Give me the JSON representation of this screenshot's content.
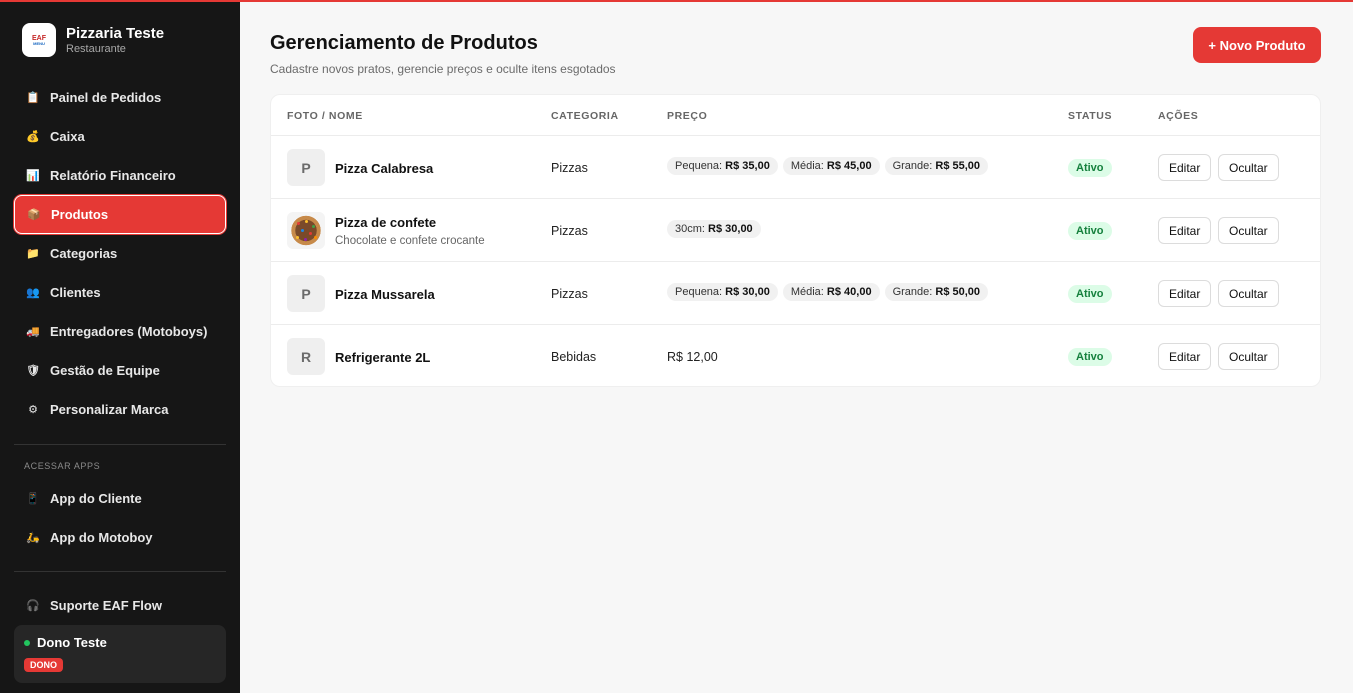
{
  "brand": {
    "name": "Pizzaria Teste",
    "subtitle": "Restaurante",
    "logo_line1": "EAF",
    "logo_line2": "MENU"
  },
  "nav": [
    {
      "label": "Painel de Pedidos",
      "icon": "clipboard-icon"
    },
    {
      "label": "Caixa",
      "icon": "money-bag-icon"
    },
    {
      "label": "Relatório Financeiro",
      "icon": "bar-chart-icon"
    },
    {
      "label": "Produtos",
      "icon": "box-icon",
      "active": true
    },
    {
      "label": "Categorias",
      "icon": "folder-icon"
    },
    {
      "label": "Clientes",
      "icon": "users-icon"
    },
    {
      "label": "Entregadores (Motoboys)",
      "icon": "truck-icon"
    },
    {
      "label": "Gestão de Equipe",
      "icon": "shield-icon"
    },
    {
      "label": "Personalizar Marca",
      "icon": "gear-icon"
    }
  ],
  "apps_label": "ACESSAR APPS",
  "apps": [
    {
      "label": "App do Cliente",
      "icon": "phone-icon"
    },
    {
      "label": "App do Motoboy",
      "icon": "scooter-icon"
    }
  ],
  "support": {
    "label": "Suporte EAF Flow",
    "icon": "headset-icon"
  },
  "user": {
    "name": "Dono Teste",
    "role": "DONO",
    "status_color": "#22c55e"
  },
  "page": {
    "title": "Gerenciamento de Produtos",
    "subtitle": "Cadastre novos pratos, gerencie preços e oculte itens esgotados",
    "new_button": "+ Novo Produto"
  },
  "table": {
    "headers": {
      "name": "FOTO / NOME",
      "category": "CATEGORIA",
      "price": "PREÇO",
      "status": "STATUS",
      "actions": "AÇÕES"
    },
    "rows": [
      {
        "initial": "P",
        "name": "Pizza Calabresa",
        "description": "",
        "category": "Pizzas",
        "prices": [
          {
            "label": "Pequena:",
            "value": "R$ 35,00"
          },
          {
            "label": "Média:",
            "value": "R$ 45,00"
          },
          {
            "label": "Grande:",
            "value": "R$ 55,00"
          }
        ],
        "status": "Ativo",
        "edit": "Editar",
        "hide": "Ocultar"
      },
      {
        "initial": "",
        "name": "Pizza de confete",
        "description": "Chocolate e confete crocante",
        "category": "Pizzas",
        "prices": [
          {
            "label": "30cm:",
            "value": "R$ 30,00"
          }
        ],
        "status": "Ativo",
        "edit": "Editar",
        "hide": "Ocultar"
      },
      {
        "initial": "P",
        "name": "Pizza Mussarela",
        "description": "",
        "category": "Pizzas",
        "prices": [
          {
            "label": "Pequena:",
            "value": "R$ 30,00"
          },
          {
            "label": "Média:",
            "value": "R$ 40,00"
          },
          {
            "label": "Grande:",
            "value": "R$ 50,00"
          }
        ],
        "status": "Ativo",
        "edit": "Editar",
        "hide": "Ocultar"
      },
      {
        "initial": "R",
        "name": "Refrigerante 2L",
        "description": "",
        "category": "Bebidas",
        "plain_price": "R$ 12,00",
        "status": "Ativo",
        "edit": "Editar",
        "hide": "Ocultar"
      }
    ]
  },
  "colors": {
    "accent": "#e53935",
    "sidebar_bg": "#161616",
    "status_bg": "#dcfce7",
    "status_text": "#15803d"
  }
}
